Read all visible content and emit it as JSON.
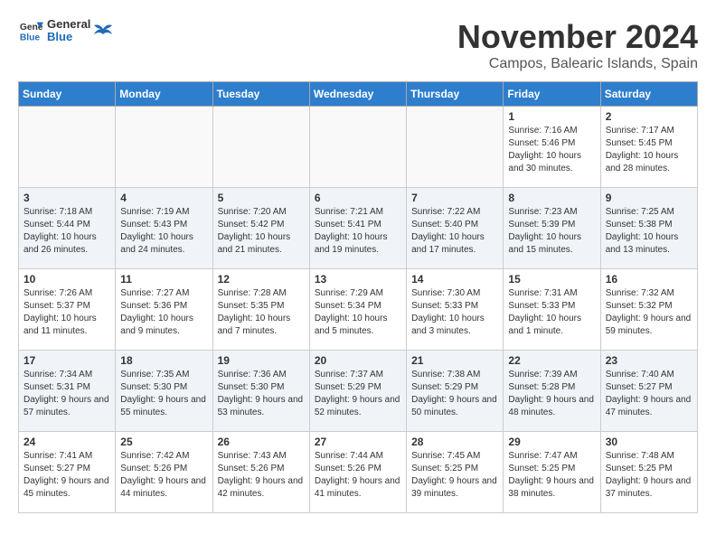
{
  "logo": {
    "text_general": "General",
    "text_blue": "Blue"
  },
  "title": "November 2024",
  "location": "Campos, Balearic Islands, Spain",
  "days_of_week": [
    "Sunday",
    "Monday",
    "Tuesday",
    "Wednesday",
    "Thursday",
    "Friday",
    "Saturday"
  ],
  "weeks": [
    {
      "days": [
        {
          "date": "",
          "empty": true
        },
        {
          "date": "",
          "empty": true
        },
        {
          "date": "",
          "empty": true
        },
        {
          "date": "",
          "empty": true
        },
        {
          "date": "",
          "empty": true
        },
        {
          "date": "1",
          "sunrise": "7:16 AM",
          "sunset": "5:46 PM",
          "daylight": "10 hours and 30 minutes."
        },
        {
          "date": "2",
          "sunrise": "7:17 AM",
          "sunset": "5:45 PM",
          "daylight": "10 hours and 28 minutes."
        }
      ]
    },
    {
      "days": [
        {
          "date": "3",
          "sunrise": "7:18 AM",
          "sunset": "5:44 PM",
          "daylight": "10 hours and 26 minutes."
        },
        {
          "date": "4",
          "sunrise": "7:19 AM",
          "sunset": "5:43 PM",
          "daylight": "10 hours and 24 minutes."
        },
        {
          "date": "5",
          "sunrise": "7:20 AM",
          "sunset": "5:42 PM",
          "daylight": "10 hours and 21 minutes."
        },
        {
          "date": "6",
          "sunrise": "7:21 AM",
          "sunset": "5:41 PM",
          "daylight": "10 hours and 19 minutes."
        },
        {
          "date": "7",
          "sunrise": "7:22 AM",
          "sunset": "5:40 PM",
          "daylight": "10 hours and 17 minutes."
        },
        {
          "date": "8",
          "sunrise": "7:23 AM",
          "sunset": "5:39 PM",
          "daylight": "10 hours and 15 minutes."
        },
        {
          "date": "9",
          "sunrise": "7:25 AM",
          "sunset": "5:38 PM",
          "daylight": "10 hours and 13 minutes."
        }
      ]
    },
    {
      "days": [
        {
          "date": "10",
          "sunrise": "7:26 AM",
          "sunset": "5:37 PM",
          "daylight": "10 hours and 11 minutes."
        },
        {
          "date": "11",
          "sunrise": "7:27 AM",
          "sunset": "5:36 PM",
          "daylight": "10 hours and 9 minutes."
        },
        {
          "date": "12",
          "sunrise": "7:28 AM",
          "sunset": "5:35 PM",
          "daylight": "10 hours and 7 minutes."
        },
        {
          "date": "13",
          "sunrise": "7:29 AM",
          "sunset": "5:34 PM",
          "daylight": "10 hours and 5 minutes."
        },
        {
          "date": "14",
          "sunrise": "7:30 AM",
          "sunset": "5:33 PM",
          "daylight": "10 hours and 3 minutes."
        },
        {
          "date": "15",
          "sunrise": "7:31 AM",
          "sunset": "5:33 PM",
          "daylight": "10 hours and 1 minute."
        },
        {
          "date": "16",
          "sunrise": "7:32 AM",
          "sunset": "5:32 PM",
          "daylight": "9 hours and 59 minutes."
        }
      ]
    },
    {
      "days": [
        {
          "date": "17",
          "sunrise": "7:34 AM",
          "sunset": "5:31 PM",
          "daylight": "9 hours and 57 minutes."
        },
        {
          "date": "18",
          "sunrise": "7:35 AM",
          "sunset": "5:30 PM",
          "daylight": "9 hours and 55 minutes."
        },
        {
          "date": "19",
          "sunrise": "7:36 AM",
          "sunset": "5:30 PM",
          "daylight": "9 hours and 53 minutes."
        },
        {
          "date": "20",
          "sunrise": "7:37 AM",
          "sunset": "5:29 PM",
          "daylight": "9 hours and 52 minutes."
        },
        {
          "date": "21",
          "sunrise": "7:38 AM",
          "sunset": "5:29 PM",
          "daylight": "9 hours and 50 minutes."
        },
        {
          "date": "22",
          "sunrise": "7:39 AM",
          "sunset": "5:28 PM",
          "daylight": "9 hours and 48 minutes."
        },
        {
          "date": "23",
          "sunrise": "7:40 AM",
          "sunset": "5:27 PM",
          "daylight": "9 hours and 47 minutes."
        }
      ]
    },
    {
      "days": [
        {
          "date": "24",
          "sunrise": "7:41 AM",
          "sunset": "5:27 PM",
          "daylight": "9 hours and 45 minutes."
        },
        {
          "date": "25",
          "sunrise": "7:42 AM",
          "sunset": "5:26 PM",
          "daylight": "9 hours and 44 minutes."
        },
        {
          "date": "26",
          "sunrise": "7:43 AM",
          "sunset": "5:26 PM",
          "daylight": "9 hours and 42 minutes."
        },
        {
          "date": "27",
          "sunrise": "7:44 AM",
          "sunset": "5:26 PM",
          "daylight": "9 hours and 41 minutes."
        },
        {
          "date": "28",
          "sunrise": "7:45 AM",
          "sunset": "5:25 PM",
          "daylight": "9 hours and 39 minutes."
        },
        {
          "date": "29",
          "sunrise": "7:47 AM",
          "sunset": "5:25 PM",
          "daylight": "9 hours and 38 minutes."
        },
        {
          "date": "30",
          "sunrise": "7:48 AM",
          "sunset": "5:25 PM",
          "daylight": "9 hours and 37 minutes."
        }
      ]
    }
  ]
}
